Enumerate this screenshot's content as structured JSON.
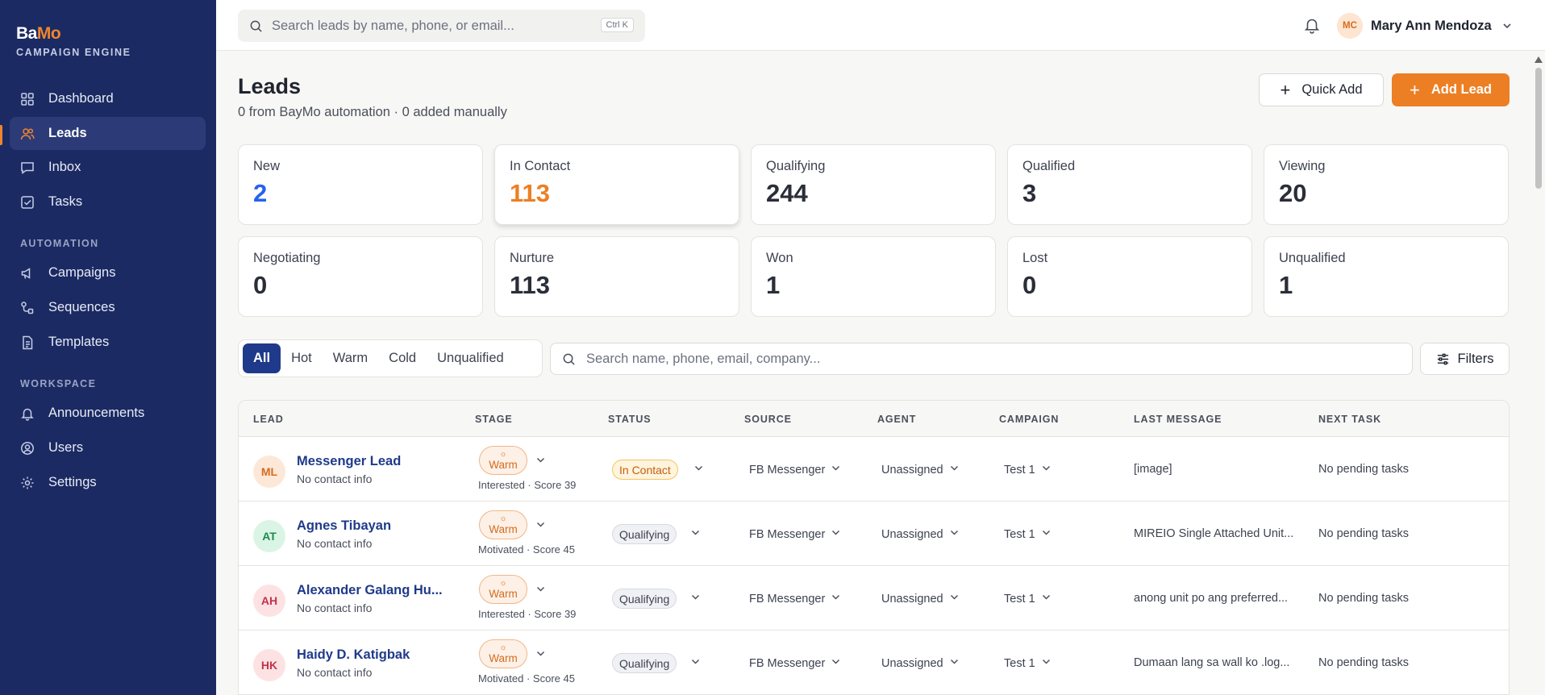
{
  "brand": {
    "name_part1": "Ba",
    "name_part2": "Mo",
    "subtitle": "CAMPAIGN ENGINE"
  },
  "sidebar": {
    "main": [
      {
        "label": "Dashboard",
        "icon": "grid-icon"
      },
      {
        "label": "Leads",
        "icon": "users-icon",
        "active": true
      },
      {
        "label": "Inbox",
        "icon": "message-icon"
      },
      {
        "label": "Tasks",
        "icon": "checkbox-icon"
      }
    ],
    "automation_label": "AUTOMATION",
    "automation": [
      {
        "label": "Campaigns",
        "icon": "megaphone-icon"
      },
      {
        "label": "Sequences",
        "icon": "sequence-icon"
      },
      {
        "label": "Templates",
        "icon": "document-icon"
      }
    ],
    "workspace_label": "WORKSPACE",
    "workspace": [
      {
        "label": "Announcements",
        "icon": "bell-icon"
      },
      {
        "label": "Users",
        "icon": "user-circle-icon"
      },
      {
        "label": "Settings",
        "icon": "gear-icon"
      }
    ]
  },
  "topbar": {
    "search_placeholder": "Search leads by name, phone, or email...",
    "search_shortcut": "Ctrl K",
    "user_initials": "MC",
    "user_name": "Mary Ann Mendoza"
  },
  "header": {
    "title": "Leads",
    "subtitle": "0 from BayMo automation · 0 added manually",
    "quick_add_label": "Quick Add",
    "add_lead_label": "Add Lead"
  },
  "stats": [
    {
      "label": "New",
      "value": "2",
      "color": "#2563eb"
    },
    {
      "label": "In Contact",
      "value": "113",
      "color": "#ec7f24"
    },
    {
      "label": "Qualifying",
      "value": "244",
      "color": "#2a2e38"
    },
    {
      "label": "Qualified",
      "value": "3",
      "color": "#2a2e38"
    },
    {
      "label": "Viewing",
      "value": "20",
      "color": "#2a2e38"
    },
    {
      "label": "Negotiating",
      "value": "0",
      "color": "#2a2e38"
    },
    {
      "label": "Nurture",
      "value": "113",
      "color": "#2a2e38"
    },
    {
      "label": "Won",
      "value": "1",
      "color": "#2a2e38"
    },
    {
      "label": "Lost",
      "value": "0",
      "color": "#2a2e38"
    },
    {
      "label": "Unqualified",
      "value": "1",
      "color": "#2a2e38"
    }
  ],
  "filters": {
    "tabs": [
      "All",
      "Hot",
      "Warm",
      "Cold",
      "Unqualified"
    ],
    "active_tab": "All",
    "search_placeholder": "Search name, phone, email, company...",
    "filters_label": "Filters"
  },
  "table": {
    "columns": [
      "LEAD",
      "STAGE",
      "STATUS",
      "SOURCE",
      "AGENT",
      "CAMPAIGN",
      "LAST MESSAGE",
      "NEXT TASK"
    ],
    "rows": [
      {
        "initials": "ML",
        "avatar_bg": "#fde8d8",
        "avatar_fg": "#d36d1e",
        "name": "Messenger Lead",
        "contact": "No contact info",
        "stage": "Warm",
        "stage_meta": "Interested · Score 39",
        "status": "In Contact",
        "status_kind": "contact",
        "source": "FB Messenger",
        "agent": "Unassigned",
        "campaign": "Test 1",
        "last_message": "[image]",
        "next_task": "No pending tasks"
      },
      {
        "initials": "AT",
        "avatar_bg": "#daf5e6",
        "avatar_fg": "#1f8a4c",
        "name": "Agnes Tibayan",
        "contact": "No contact info",
        "stage": "Warm",
        "stage_meta": "Motivated · Score 45",
        "status": "Qualifying",
        "status_kind": "qual",
        "source": "FB Messenger",
        "agent": "Unassigned",
        "campaign": "Test 1",
        "last_message": "MIREIO Single Attached Unit...",
        "next_task": "No pending tasks"
      },
      {
        "initials": "AH",
        "avatar_bg": "#fde2e4",
        "avatar_fg": "#c2334a",
        "name": "Alexander Galang Hu...",
        "contact": "No contact info",
        "stage": "Warm",
        "stage_meta": "Interested · Score 39",
        "status": "Qualifying",
        "status_kind": "qual",
        "source": "FB Messenger",
        "agent": "Unassigned",
        "campaign": "Test 1",
        "last_message": "anong unit po ang preferred...",
        "next_task": "No pending tasks"
      },
      {
        "initials": "HK",
        "avatar_bg": "#fde2e4",
        "avatar_fg": "#c2334a",
        "name": "Haidy D. Katigbak",
        "contact": "No contact info",
        "stage": "Warm",
        "stage_meta": "Motivated · Score 45",
        "status": "Qualifying",
        "status_kind": "qual",
        "source": "FB Messenger",
        "agent": "Unassigned",
        "campaign": "Test 1",
        "last_message": "Dumaan lang sa wall ko .log...",
        "next_task": "No pending tasks"
      }
    ]
  }
}
